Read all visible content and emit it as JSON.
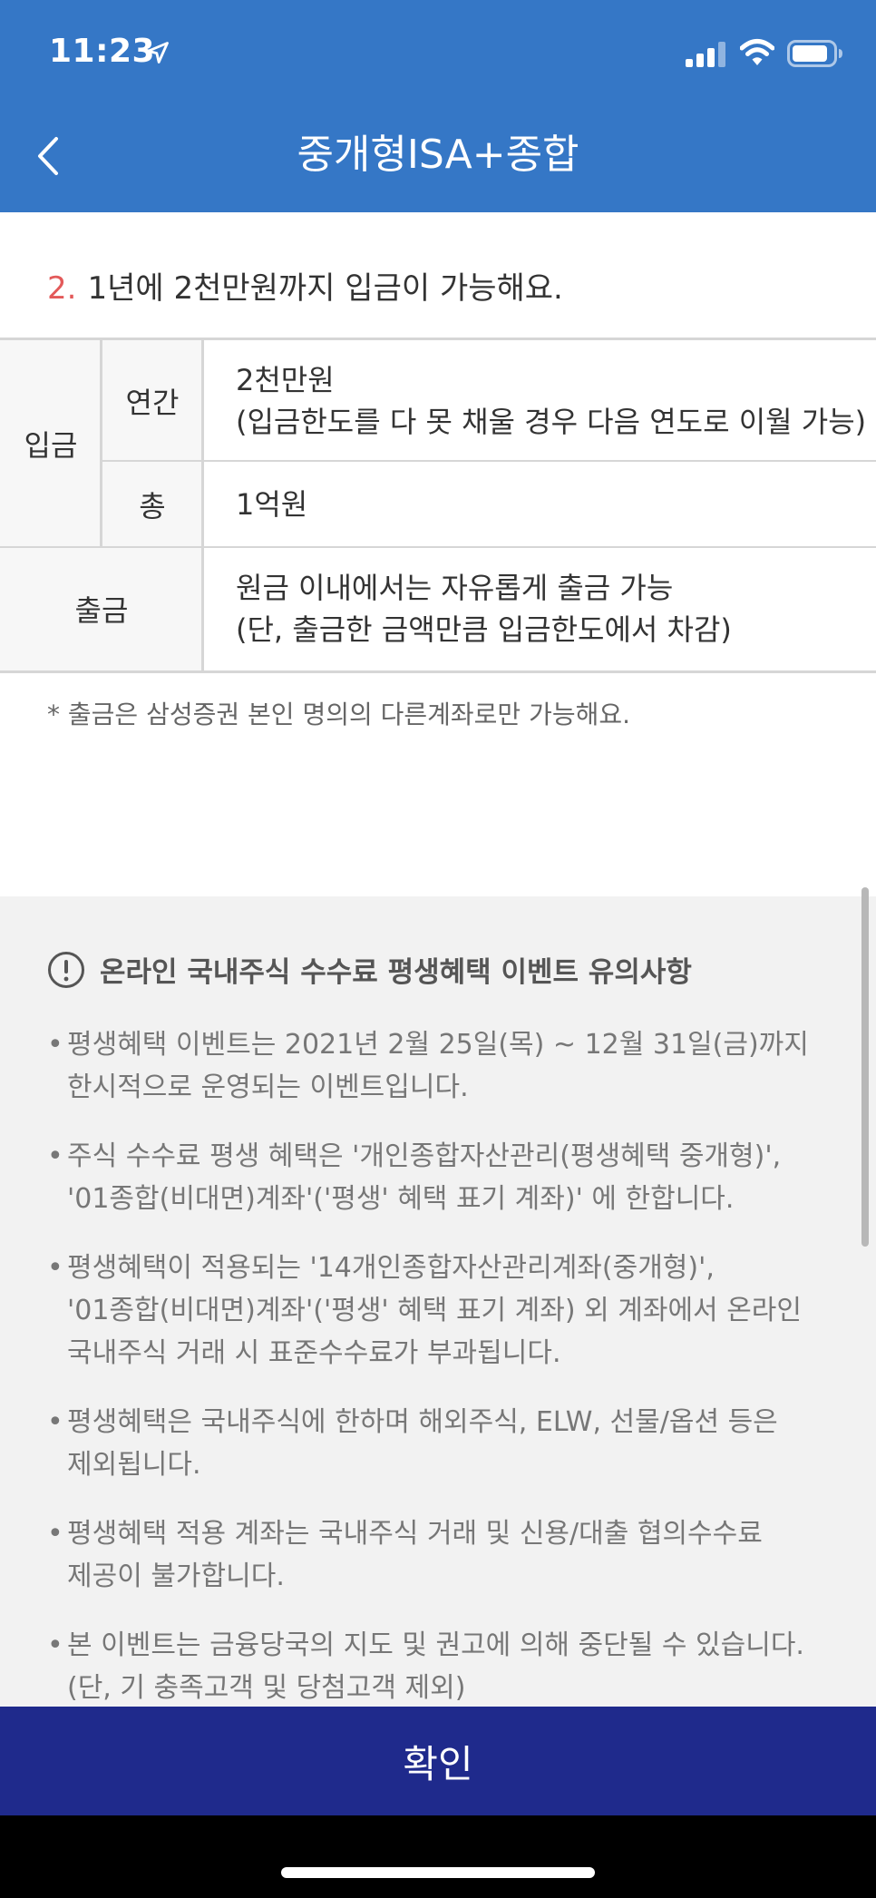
{
  "status_bar": {
    "time": "11:23",
    "location_icon": "location-arrow-icon",
    "signal_icon": "cellular-signal-icon",
    "wifi_icon": "wifi-icon",
    "battery_icon": "battery-icon"
  },
  "nav": {
    "back_icon": "chevron-left-icon",
    "title": "중개형ISA+종합"
  },
  "section": {
    "number": "2.",
    "heading": "1년에 2천만원까지 입금이 가능해요."
  },
  "table": {
    "deposit_label": "입금",
    "annual_label": "연간",
    "annual_line1": "2천만원",
    "annual_line2": "(입금한도를 다 못 채울 경우 다음 연도로 이월 가능)",
    "total_label": "총",
    "total_value": "1억원",
    "withdraw_label": "출금",
    "withdraw_line1": "원금 이내에서는 자유롭게 출금 가능",
    "withdraw_line2": "(단, 출금한 금액만큼 입금한도에서 차감)"
  },
  "footnote": "* 출금은 삼성증권 본인 명의의 다른계좌로만 가능해요.",
  "notice": {
    "icon": "info-circle-icon",
    "title": "온라인 국내주식 수수료 평생혜택 이벤트 유의사항",
    "items": [
      "평생혜택 이벤트는 2021년 2월 25일(목) ~ 12월 31일(금)까지\n한시적으로 운영되는 이벤트입니다.",
      "주식 수수료 평생 혜택은 '개인종합자산관리(평생혜택 중개형)',\n'01종합(비대면)계좌'('평생' 혜택 표기 계좌)' 에 한합니다.",
      "평생혜택이 적용되는 '14개인종합자산관리계좌(중개형)',\n'01종합(비대면)계좌'('평생' 혜택 표기 계좌) 외 계좌에서 온라인\n국내주식 거래 시 표준수수료가 부과됩니다.",
      "평생혜택은 국내주식에 한하며 해외주식, ELW, 선물/옵션 등은\n제외됩니다.",
      "평생혜택 적용 계좌는 국내주식 거래 및 신용/대출 협의수수료\n제공이 불가합니다.",
      "본 이벤트는 금융당국의 지도 및 권고에 의해 중단될 수 있습니다.\n(단, 기 충족고객 및 당첨고객 제외)"
    ]
  },
  "confirm_label": "확인",
  "colors": {
    "header_bg": "#3577c6",
    "accent_number": "#e35a5a",
    "confirm_bg": "#1f2a8c",
    "notice_bg": "#f2f2f2"
  }
}
